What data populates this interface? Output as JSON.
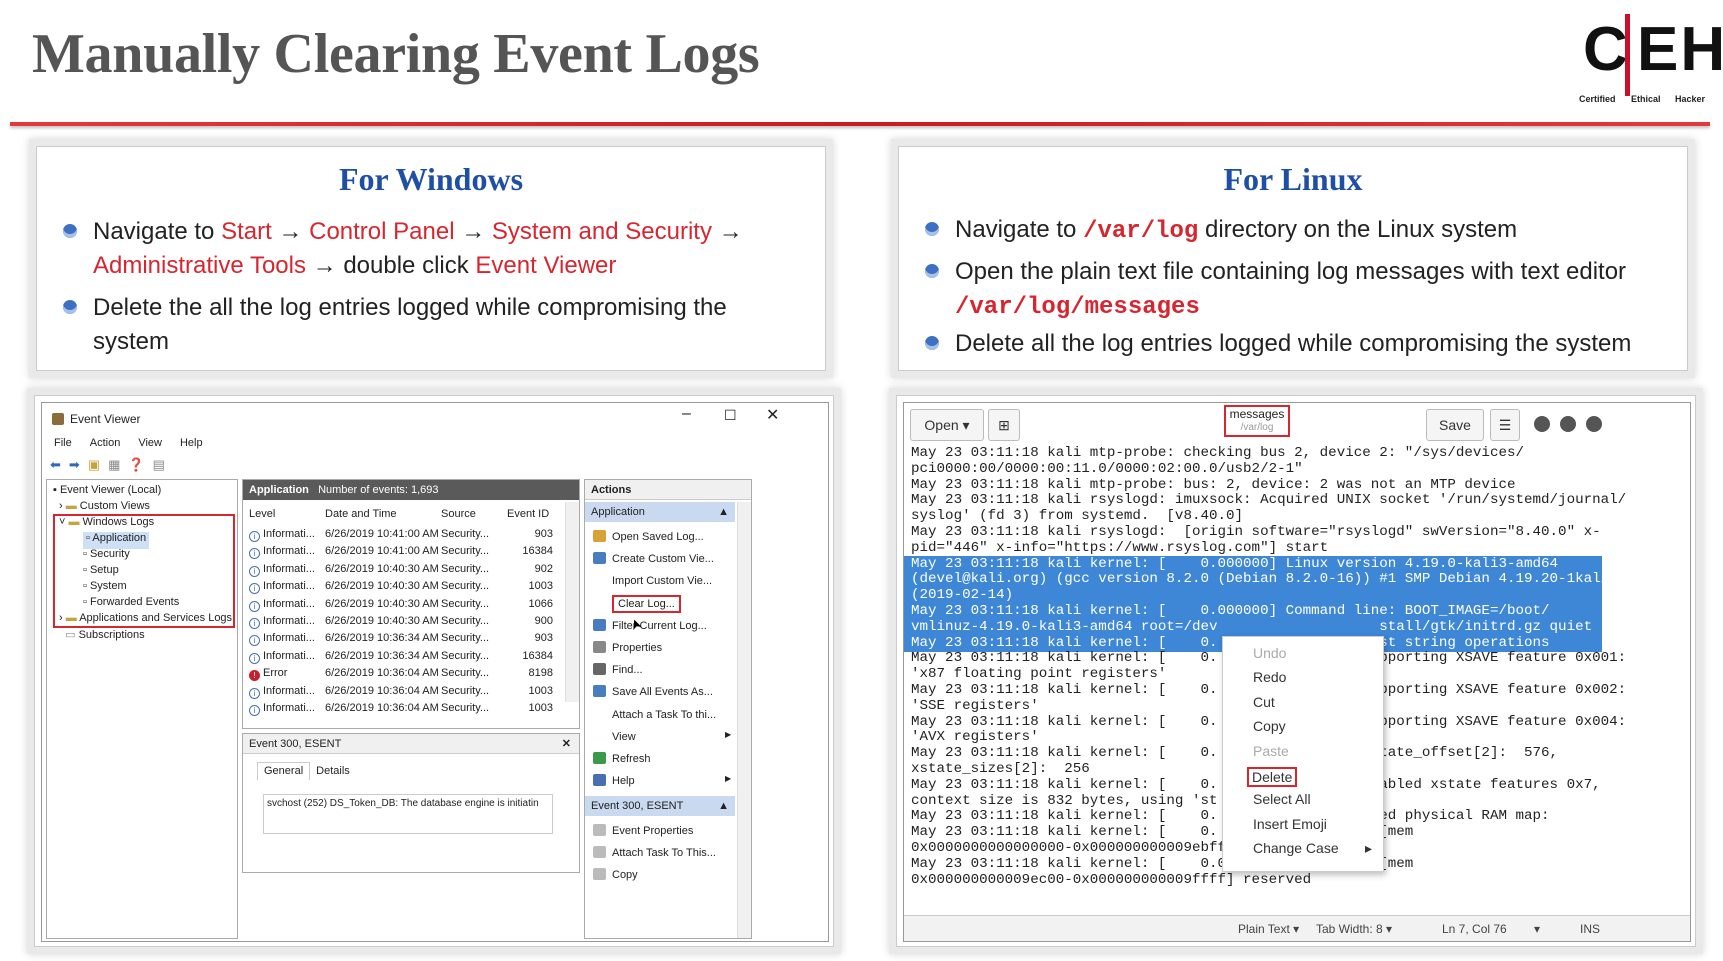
{
  "slide": {
    "title": "Manually Clearing Event Logs",
    "logo": {
      "text": "CEH",
      "sub1": "Certified",
      "sub2": "Ethical",
      "sub3": "Hacker"
    },
    "accent": "#d7262f"
  },
  "windows": {
    "heading": "For Windows",
    "b1": {
      "t1": "Navigate to ",
      "start": "Start",
      "arrow": " → ",
      "cp": "Control Panel",
      "ss": "System and Security",
      "at": "Administrative Tools",
      "dc": " double click ",
      "ev": "Event Viewer"
    },
    "b2": "Delete the all the log entries logged while compromising the system"
  },
  "linux": {
    "heading": "For Linux",
    "b1a": "Navigate to ",
    "b1path": "/var/log",
    "b1b": " directory on the Linux system",
    "b2": "Open the plain text file containing log messages with text editor",
    "b2path": "/var/log/messages",
    "b3": "Delete all the log entries logged while compromising the system"
  },
  "event_viewer": {
    "title": "Event Viewer",
    "menu": [
      "File",
      "Action",
      "View",
      "Help"
    ],
    "tree": [
      "Event Viewer (Local)",
      "Custom Views",
      "Windows Logs",
      "Application",
      "Security",
      "Setup",
      "System",
      "Forwarded Events",
      "Applications and Services Logs",
      "Subscriptions"
    ],
    "center_title": "Application",
    "center_count": "Number of events: 1,693",
    "columns": [
      "Level",
      "Date and Time",
      "Source",
      "Event ID"
    ],
    "rows": [
      [
        "Informati...",
        "6/26/2019 10:41:00 AM",
        "Security...",
        "903"
      ],
      [
        "Informati...",
        "6/26/2019 10:41:00 AM",
        "Security...",
        "16384"
      ],
      [
        "Informati...",
        "6/26/2019 10:40:30 AM",
        "Security...",
        "902"
      ],
      [
        "Informati...",
        "6/26/2019 10:40:30 AM",
        "Security...",
        "1003"
      ],
      [
        "Informati...",
        "6/26/2019 10:40:30 AM",
        "Security...",
        "1066"
      ],
      [
        "Informati...",
        "6/26/2019 10:40:30 AM",
        "Security...",
        "900"
      ],
      [
        "Informati...",
        "6/26/2019 10:36:34 AM",
        "Security...",
        "903"
      ],
      [
        "Informati...",
        "6/26/2019 10:36:34 AM",
        "Security...",
        "16384"
      ],
      [
        "Error",
        "6/26/2019 10:36:04 AM",
        "Security...",
        "8198"
      ],
      [
        "Informati...",
        "6/26/2019 10:36:04 AM",
        "Security...",
        "1003"
      ],
      [
        "Informati...",
        "6/26/2019 10:36:04 AM",
        "Security...",
        "1003"
      ]
    ],
    "detail_title": "Event 300, ESENT",
    "detail_tabs": [
      "General",
      "Details"
    ],
    "detail_text": "svchost (252) DS_Token_DB: The database engine is initiatin",
    "actions_title": "Actions",
    "actions_group1": "Application",
    "actions1": [
      "Open Saved Log...",
      "Create Custom Vie...",
      "Import Custom Vie...",
      "Clear Log...",
      "Filter Current Log...",
      "Properties",
      "Find...",
      "Save All Events As...",
      "Attach a Task To thi...",
      "View",
      "Refresh",
      "Help"
    ],
    "actions_group2": "Event 300, ESENT",
    "actions2": [
      "Event Properties",
      "Attach Task To This...",
      "Copy"
    ]
  },
  "editor": {
    "open_label": "Open",
    "file_name": "messages",
    "file_path": "/var/log",
    "save_label": "Save",
    "lines": [
      "May 23 03:11:18 kali mtp-probe: checking bus 2, device 2: \"/sys/devices/",
      "pci0000:00/0000:00:11.0/0000:02:00.0/usb2/2-1\"",
      "May 23 03:11:18 kali mtp-probe: bus: 2, device: 2 was not an MTP device",
      "May 23 03:11:18 kali rsyslogd: imuxsock: Acquired UNIX socket '/run/systemd/journal/",
      "syslog' (fd 3) from systemd.  [v8.40.0]",
      "May 23 03:11:18 kali rsyslogd:  [origin software=\"rsyslogd\" swVersion=\"8.40.0\" x-",
      "pid=\"446\" x-info=\"https://www.rsyslog.com\"] start",
      "May 23 03:11:18 kali kernel: [    0.000000] Linux version 4.19.0-kali3-amd64",
      "(devel@kali.org) (gcc version 8.2.0 (Debian 8.2.0-16)) #1 SMP Debian 4.19.20-1kali1",
      "(2019-02-14)",
      "May 23 03:11:18 kali kernel: [    0.000000] Command line: BOOT_IMAGE=/boot/",
      "vmlinuz-4.19.0-kali3-amd64 root=/dev                   stall/gtk/initrd.gz quiet",
      "May 23 03:11:18 kali kernel: [    0.                   st string operations",
      "May 23 03:11:18 kali kernel: [    0.                   pporting XSAVE feature 0x001:",
      "'x87 floating point registers'",
      "May 23 03:11:18 kali kernel: [    0.                   pporting XSAVE feature 0x002:",
      "'SSE registers'",
      "May 23 03:11:18 kali kernel: [    0.                   pporting XSAVE feature 0x004:",
      "'AVX registers'",
      "May 23 03:11:18 kali kernel: [    0.                   tate_offset[2]:  576,",
      "xstate_sizes[2]:  256",
      "May 23 03:11:18 kali kernel: [    0.                   abled xstate features 0x7,",
      "context size is 832 bytes, using 'st",
      "May 23 03:11:18 kali kernel: [    0.                   ed physical RAM map:",
      "May 23 03:11:18 kali kernel: [    0.                   [mem",
      "0x0000000000000000-0x000000000009ebff] usable",
      "May 23 03:11:18 kali kernel: [    0.000000] BIOS-e820: [mem",
      "0x000000000009ec00-0x000000000009ffff] reserved"
    ],
    "context_menu": [
      "Undo",
      "Redo",
      "Cut",
      "Copy",
      "Paste",
      "Delete",
      "Select All",
      "Insert Emoji",
      "Change Case"
    ],
    "status_plain": "Plain Text",
    "status_tab": "Tab Width: 8",
    "status_pos": "Ln 7, Col 76",
    "status_ins": "INS"
  }
}
